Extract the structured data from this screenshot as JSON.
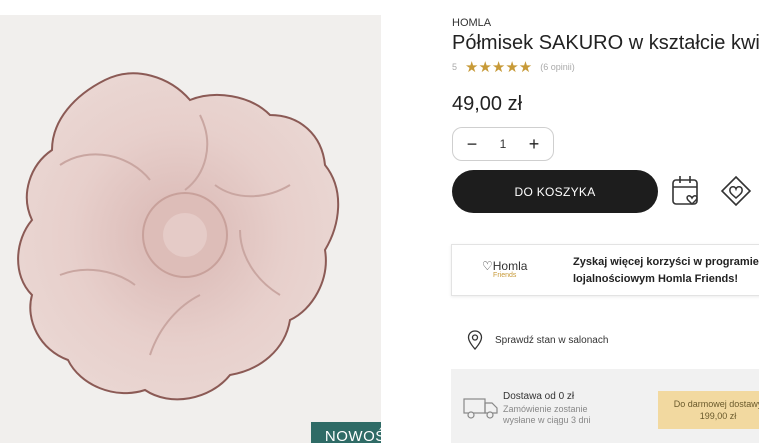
{
  "product": {
    "brand": "HOMLA",
    "title": "Półmisek SAKURO w kształcie kwiata",
    "rating_value": "5",
    "stars": "★★★★★",
    "reviews": "(6 opinii)",
    "price": "49,00 zł",
    "quantity": "1",
    "qty_minus": "−",
    "qty_plus": "+",
    "add_to_cart": "DO KOSZYKA",
    "badge": "NOWOŚĆ"
  },
  "promo": {
    "logo_main": "♡Homla",
    "logo_sub": "Friends",
    "line1": "Zyskaj więcej korzyści w programie",
    "line2": "lojalnościowym Homla Friends!"
  },
  "store": {
    "label": "Sprawdź stan w salonach"
  },
  "delivery": {
    "title": "Dostawa od 0 zł",
    "subtitle": "Zamówienie zostanie wysłane w ciągu 3 dni",
    "free_line1": "Do darmowej dostawy",
    "free_line2": "199,00 zł"
  },
  "icons": [
    "calendar-heart-icon",
    "heart-diamond-icon",
    "location-pin-icon",
    "truck-icon"
  ],
  "colors": {
    "badge": "#2f6b66",
    "cart_button": "#1d1d1d",
    "stars": "#c79a38",
    "free_box": "#f2d9a0"
  }
}
